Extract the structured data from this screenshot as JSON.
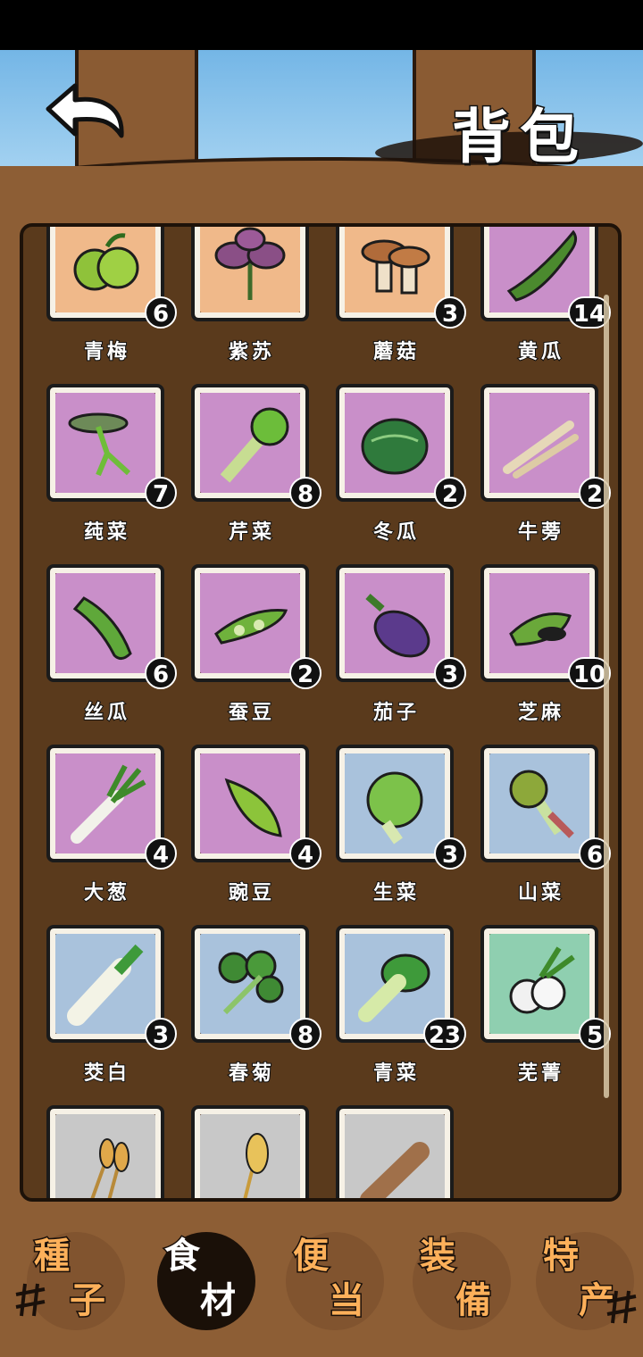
{
  "header": {
    "title": "背包",
    "back_icon": "back-arrow-icon"
  },
  "items": [
    {
      "name": "青梅",
      "count": "6",
      "bg": "#f0b98a",
      "icon": "green-plum-icon"
    },
    {
      "name": "紫苏",
      "count": "",
      "bg": "#f0b98a",
      "icon": "perilla-icon"
    },
    {
      "name": "蘑菇",
      "count": "3",
      "bg": "#f0b98a",
      "icon": "mushroom-icon"
    },
    {
      "name": "黄瓜",
      "count": "14",
      "bg": "#c98fc9",
      "icon": "cucumber-icon"
    },
    {
      "name": "莼菜",
      "count": "7",
      "bg": "#c98fc9",
      "icon": "water-shield-icon"
    },
    {
      "name": "芹菜",
      "count": "8",
      "bg": "#c98fc9",
      "icon": "celery-icon"
    },
    {
      "name": "冬瓜",
      "count": "2",
      "bg": "#c98fc9",
      "icon": "winter-melon-icon"
    },
    {
      "name": "牛蒡",
      "count": "2",
      "bg": "#c98fc9",
      "icon": "burdock-icon"
    },
    {
      "name": "丝瓜",
      "count": "6",
      "bg": "#c98fc9",
      "icon": "loofah-icon"
    },
    {
      "name": "蚕豆",
      "count": "2",
      "bg": "#c98fc9",
      "icon": "broad-bean-icon"
    },
    {
      "name": "茄子",
      "count": "3",
      "bg": "#c98fc9",
      "icon": "eggplant-icon"
    },
    {
      "name": "芝麻",
      "count": "10",
      "bg": "#c98fc9",
      "icon": "sesame-icon"
    },
    {
      "name": "大葱",
      "count": "4",
      "bg": "#c98fc9",
      "icon": "scallion-icon"
    },
    {
      "name": "豌豆",
      "count": "4",
      "bg": "#c98fc9",
      "icon": "pea-icon"
    },
    {
      "name": "生菜",
      "count": "3",
      "bg": "#a9c2dc",
      "icon": "lettuce-icon"
    },
    {
      "name": "山菜",
      "count": "6",
      "bg": "#a9c2dc",
      "icon": "wild-vegetable-icon"
    },
    {
      "name": "茭白",
      "count": "3",
      "bg": "#a9c2dc",
      "icon": "water-bamboo-icon"
    },
    {
      "name": "春菊",
      "count": "8",
      "bg": "#a9c2dc",
      "icon": "crown-daisy-icon"
    },
    {
      "name": "青菜",
      "count": "23",
      "bg": "#a9c2dc",
      "icon": "bok-choy-icon"
    },
    {
      "name": "芜菁",
      "count": "5",
      "bg": "#8fcfb0",
      "icon": "turnip-icon"
    },
    {
      "name": "",
      "count": "",
      "bg": "#c8c8c8",
      "icon": "wheat-icon"
    },
    {
      "name": "",
      "count": "",
      "bg": "#c8c8c8",
      "icon": "barley-icon"
    },
    {
      "name": "",
      "count": "",
      "bg": "#c8c8c8",
      "icon": "yam-icon"
    }
  ],
  "tabs": [
    {
      "c1": "種",
      "c2": "子",
      "active": false
    },
    {
      "c1": "食",
      "c2": "材",
      "active": true
    },
    {
      "c1": "便",
      "c2": "当",
      "active": false
    },
    {
      "c1": "装",
      "c2": "備",
      "active": false
    },
    {
      "c1": "特",
      "c2": "产",
      "active": false
    }
  ],
  "colors": {
    "panel": "#5a3a1c",
    "board": "#8d5e35",
    "tab_text": "#fdb05a"
  }
}
